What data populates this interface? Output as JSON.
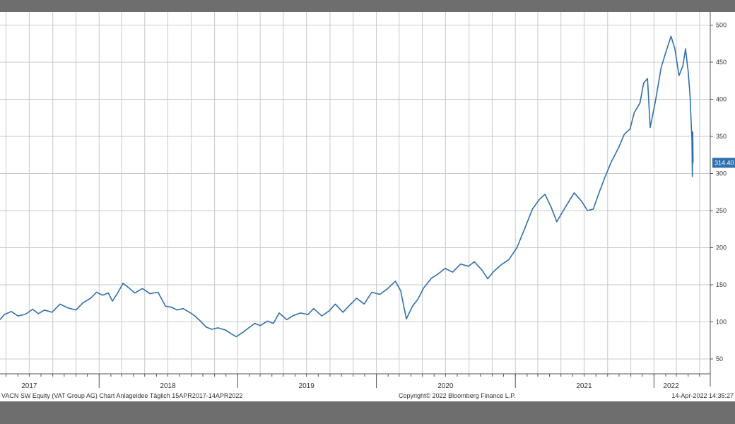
{
  "colors": {
    "line": "#2f6fae",
    "grid": "#c9c9c9",
    "background": "#ffffff",
    "frame": "#6e6e6e",
    "last_price_tag": "#2f6fae"
  },
  "footer": {
    "left": "VACN SW Equity (VAT Group AG) Chart Anlageidee  Täglich 15APR2017-14APR2022",
    "center": "Copyright© 2022 Bloomberg Finance L.P.",
    "right": "14-Apr-2022 14:35:27"
  },
  "chart_data": {
    "type": "line",
    "title": "",
    "xlabel": "",
    "ylabel": "",
    "x_range": [
      "2017-04-15",
      "2022-04-14"
    ],
    "ylim": [
      30,
      510
    ],
    "y_ticks": [
      50,
      100,
      150,
      200,
      250,
      300,
      350,
      400,
      450,
      500
    ],
    "x_tick_labels": [
      {
        "label": "2017",
        "date": "2017-07-01"
      },
      {
        "label": "2018",
        "date": "2018-07-01"
      },
      {
        "label": "2019",
        "date": "2019-07-01"
      },
      {
        "label": "2020",
        "date": "2020-07-01"
      },
      {
        "label": "2021",
        "date": "2021-07-01"
      },
      {
        "label": "2022",
        "date": "2022-02-15"
      }
    ],
    "grid": true,
    "last_price_label": "314.40",
    "series": [
      {
        "points": [
          [
            "2017-04-15",
            103
          ],
          [
            "2017-04-27",
            110
          ],
          [
            "2017-05-15",
            114
          ],
          [
            "2017-06-01",
            108
          ],
          [
            "2017-06-20",
            110
          ],
          [
            "2017-07-10",
            117
          ],
          [
            "2017-07-25",
            111
          ],
          [
            "2017-08-10",
            116
          ],
          [
            "2017-08-30",
            113
          ],
          [
            "2017-09-20",
            124
          ],
          [
            "2017-10-10",
            119
          ],
          [
            "2017-11-01",
            116
          ],
          [
            "2017-11-20",
            126
          ],
          [
            "2017-12-10",
            132
          ],
          [
            "2017-12-25",
            140
          ],
          [
            "2018-01-10",
            136
          ],
          [
            "2018-01-25",
            139
          ],
          [
            "2018-02-05",
            128
          ],
          [
            "2018-02-20",
            140
          ],
          [
            "2018-03-05",
            152
          ],
          [
            "2018-03-20",
            146
          ],
          [
            "2018-04-05",
            139
          ],
          [
            "2018-04-25",
            145
          ],
          [
            "2018-05-15",
            138
          ],
          [
            "2018-06-05",
            140
          ],
          [
            "2018-06-25",
            121
          ],
          [
            "2018-07-10",
            120
          ],
          [
            "2018-07-25",
            116
          ],
          [
            "2018-08-10",
            118
          ],
          [
            "2018-08-30",
            112
          ],
          [
            "2018-09-10",
            108
          ],
          [
            "2018-09-25",
            101
          ],
          [
            "2018-10-10",
            93
          ],
          [
            "2018-10-25",
            90
          ],
          [
            "2018-11-10",
            92
          ],
          [
            "2018-11-30",
            89
          ],
          [
            "2018-12-15",
            84
          ],
          [
            "2018-12-28",
            80
          ],
          [
            "2019-01-15",
            86
          ],
          [
            "2019-01-30",
            92
          ],
          [
            "2019-02-15",
            98
          ],
          [
            "2019-03-01",
            95
          ],
          [
            "2019-03-20",
            101
          ],
          [
            "2019-04-05",
            98
          ],
          [
            "2019-04-20",
            112
          ],
          [
            "2019-05-10",
            103
          ],
          [
            "2019-05-25",
            108
          ],
          [
            "2019-06-15",
            112
          ],
          [
            "2019-07-05",
            110
          ],
          [
            "2019-07-20",
            118
          ],
          [
            "2019-08-10",
            108
          ],
          [
            "2019-08-30",
            115
          ],
          [
            "2019-09-15",
            124
          ],
          [
            "2019-10-05",
            113
          ],
          [
            "2019-10-20",
            121
          ],
          [
            "2019-11-10",
            132
          ],
          [
            "2019-11-30",
            124
          ],
          [
            "2019-12-20",
            140
          ],
          [
            "2020-01-10",
            137
          ],
          [
            "2020-01-31",
            145
          ],
          [
            "2020-02-20",
            155
          ],
          [
            "2020-03-05",
            142
          ],
          [
            "2020-03-20",
            104
          ],
          [
            "2020-04-05",
            121
          ],
          [
            "2020-04-20",
            131
          ],
          [
            "2020-05-05",
            146
          ],
          [
            "2020-05-25",
            159
          ],
          [
            "2020-06-10",
            164
          ],
          [
            "2020-06-30",
            172
          ],
          [
            "2020-07-20",
            167
          ],
          [
            "2020-08-10",
            178
          ],
          [
            "2020-08-30",
            175
          ],
          [
            "2020-09-15",
            181
          ],
          [
            "2020-10-05",
            170
          ],
          [
            "2020-10-20",
            158
          ],
          [
            "2020-11-05",
            168
          ],
          [
            "2020-11-25",
            177
          ],
          [
            "2020-12-15",
            184
          ],
          [
            "2021-01-05",
            200
          ],
          [
            "2021-01-25",
            225
          ],
          [
            "2021-02-15",
            252
          ],
          [
            "2021-03-05",
            265
          ],
          [
            "2021-03-20",
            272
          ],
          [
            "2021-04-05",
            255
          ],
          [
            "2021-04-20",
            235
          ],
          [
            "2021-05-05",
            248
          ],
          [
            "2021-05-25",
            265
          ],
          [
            "2021-06-05",
            274
          ],
          [
            "2021-06-25",
            262
          ],
          [
            "2021-07-10",
            250
          ],
          [
            "2021-07-25",
            252
          ],
          [
            "2021-08-10",
            275
          ],
          [
            "2021-08-25",
            295
          ],
          [
            "2021-09-10",
            315
          ],
          [
            "2021-09-30",
            335
          ],
          [
            "2021-10-15",
            353
          ],
          [
            "2021-10-30",
            360
          ],
          [
            "2021-11-10",
            382
          ],
          [
            "2021-11-25",
            395
          ],
          [
            "2021-12-05",
            422
          ],
          [
            "2021-12-15",
            428
          ],
          [
            "2021-12-22",
            362
          ],
          [
            "2022-01-05",
            398
          ],
          [
            "2022-01-20",
            443
          ],
          [
            "2022-02-01",
            463
          ],
          [
            "2022-02-15",
            485
          ],
          [
            "2022-02-25",
            468
          ],
          [
            "2022-03-08",
            432
          ],
          [
            "2022-03-18",
            445
          ],
          [
            "2022-03-25",
            468
          ],
          [
            "2022-04-01",
            438
          ],
          [
            "2022-04-06",
            405
          ],
          [
            "2022-04-09",
            368
          ],
          [
            "2022-04-11",
            345
          ],
          [
            "2022-04-12",
            296
          ],
          [
            "2022-04-13",
            348
          ],
          [
            "2022-04-13",
            356
          ],
          [
            "2022-04-14",
            314.4
          ]
        ]
      }
    ]
  }
}
